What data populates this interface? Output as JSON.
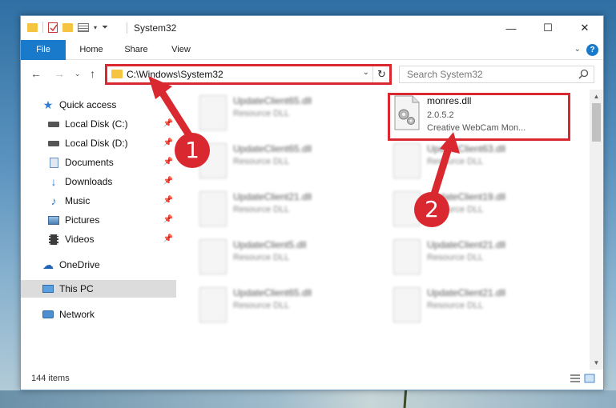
{
  "window": {
    "title": "System32",
    "controls": {
      "minimize": "—",
      "maximize": "☐",
      "close": "✕"
    }
  },
  "ribbon": {
    "tabs": [
      "File",
      "Home",
      "Share",
      "View"
    ],
    "help": "?"
  },
  "navigation": {
    "address": "C:\\Windows\\System32",
    "search_placeholder": "Search System32"
  },
  "sidebar": {
    "items": [
      {
        "label": "Quick access",
        "icon": "star-icon"
      },
      {
        "label": "Local Disk (C:)",
        "icon": "drive-icon",
        "pinned": true
      },
      {
        "label": "Local Disk (D:)",
        "icon": "drive-icon",
        "pinned": true
      },
      {
        "label": "Documents",
        "icon": "documents-icon",
        "pinned": true
      },
      {
        "label": "Downloads",
        "icon": "download-icon",
        "pinned": true
      },
      {
        "label": "Music",
        "icon": "music-icon",
        "pinned": true
      },
      {
        "label": "Pictures",
        "icon": "pictures-icon",
        "pinned": true
      },
      {
        "label": "Videos",
        "icon": "videos-icon",
        "pinned": true
      },
      {
        "label": "OneDrive",
        "icon": "cloud-icon"
      },
      {
        "label": "This PC",
        "icon": "monitor-icon",
        "selected": true
      },
      {
        "label": "Network",
        "icon": "network-icon"
      }
    ]
  },
  "files": {
    "highlighted": {
      "name": "monres.dll",
      "version": "2.0.5.2",
      "description": "Creative WebCam Mon..."
    },
    "blurred": [
      {
        "name": "UpdateClient65.dll",
        "description": "Resource DLL"
      },
      {
        "name": "UpdateClient65.dll",
        "description": "Resource DLL"
      },
      {
        "name": "UpdateClient63.dll",
        "description": "Resource DLL"
      },
      {
        "name": "UpdateClient21.dll",
        "description": "Resource DLL"
      },
      {
        "name": "UpdateClient19.dll",
        "description": "Resource DLL"
      },
      {
        "name": "UpdateClient5.dll",
        "description": "Resource DLL"
      },
      {
        "name": "UpdateClient21.dll",
        "description": "Resource DLL"
      },
      {
        "name": "UpdateClient65.dll",
        "description": "Resource DLL"
      },
      {
        "name": "UpdateClient21.dll",
        "description": "Resource DLL"
      }
    ]
  },
  "status": {
    "item_count": "144 items"
  },
  "annotations": {
    "step1": "1",
    "step2": "2",
    "color": "#d9282f"
  }
}
